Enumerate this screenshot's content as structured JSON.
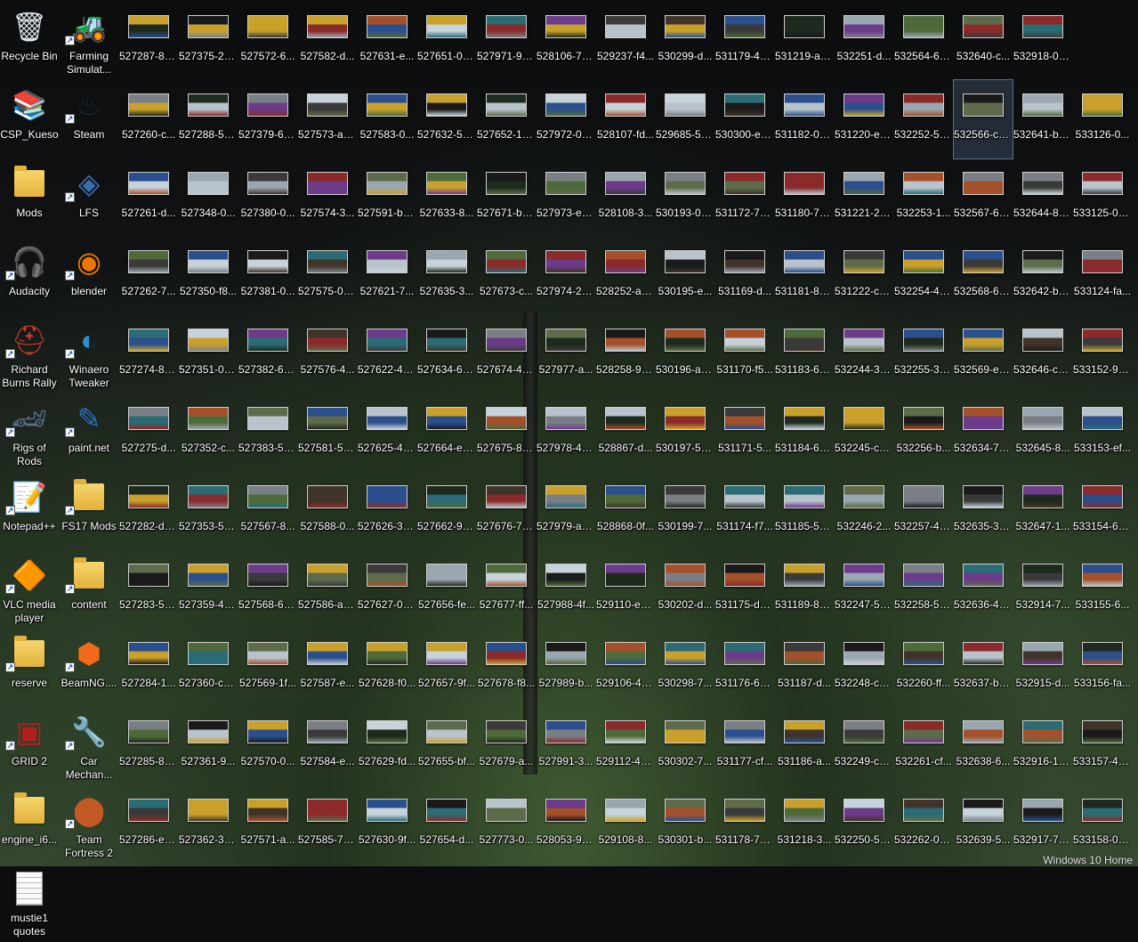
{
  "watermark": "Windows 10 Home",
  "apps": [
    {
      "label": "Recycle Bin",
      "icon": "recycle-bin-icon",
      "glyph": "🗑",
      "color": "#dfe6ee",
      "shortcut": false
    },
    {
      "label": "Farming Simulat...",
      "icon": "farming-simulator-icon",
      "glyph": "🚜",
      "color": "#7fa84a",
      "shortcut": true
    },
    {
      "label": "CSP_Kueso",
      "icon": "winrar-archive-icon",
      "glyph": "📚",
      "color": "#8a3b9e",
      "shortcut": false
    },
    {
      "label": "Steam",
      "icon": "steam-icon",
      "glyph": "♨",
      "color": "#1b2838",
      "shortcut": true
    },
    {
      "label": "Mods",
      "icon": "folder-icon",
      "glyph": "",
      "color": "#e3b23c",
      "shortcut": false,
      "type": "folder"
    },
    {
      "label": "LFS",
      "icon": "lfs-icon",
      "glyph": "◈",
      "color": "#3c6fb0",
      "shortcut": true
    },
    {
      "label": "Audacity",
      "icon": "audacity-icon",
      "glyph": "🎧",
      "color": "#f07a1a",
      "shortcut": true
    },
    {
      "label": "blender",
      "icon": "blender-icon",
      "glyph": "◉",
      "color": "#ea7600",
      "shortcut": true
    },
    {
      "label": "Richard Burns Rally",
      "icon": "helmet-icon",
      "glyph": "⛑",
      "color": "#c0392b",
      "shortcut": true
    },
    {
      "label": "Winaero Tweaker",
      "icon": "winaero-tweaker-icon",
      "glyph": "◐",
      "color": "#2b8fd6",
      "shortcut": true
    },
    {
      "label": "Rigs of Rods",
      "icon": "rigs-of-rods-icon",
      "glyph": "🏎",
      "color": "#5d6f8c",
      "shortcut": true
    },
    {
      "label": "paint.net",
      "icon": "paint-net-icon",
      "glyph": "✎",
      "color": "#2d6fc0",
      "shortcut": true
    },
    {
      "label": "Notepad++",
      "icon": "notepad-plus-plus-icon",
      "glyph": "📝",
      "color": "#8fbf3f",
      "shortcut": true
    },
    {
      "label": "FS17 Mods",
      "icon": "folder-icon",
      "glyph": "",
      "color": "#e3b23c",
      "shortcut": true,
      "type": "folder"
    },
    {
      "label": "VLC media player",
      "icon": "vlc-icon",
      "glyph": "🔶",
      "color": "#f48b00",
      "shortcut": true
    },
    {
      "label": "content",
      "icon": "folder-icon",
      "glyph": "",
      "color": "#e3b23c",
      "shortcut": true,
      "type": "folder"
    },
    {
      "label": "reserve",
      "icon": "folder-icon",
      "glyph": "",
      "color": "#e3b23c",
      "shortcut": true,
      "type": "folder"
    },
    {
      "label": "BeamNG....",
      "icon": "beamng-icon",
      "glyph": "⬢",
      "color": "#f26a1b",
      "shortcut": true
    },
    {
      "label": "GRID 2",
      "icon": "grid2-icon",
      "glyph": "▣",
      "color": "#b21f1f",
      "shortcut": true
    },
    {
      "label": "Car Mechan...",
      "icon": "car-mechanic-icon",
      "glyph": "🔧",
      "color": "#e05a1a",
      "shortcut": true
    },
    {
      "label": "engine_i6...",
      "icon": "folder-icon",
      "glyph": "",
      "color": "#e3b23c",
      "shortcut": false,
      "type": "folder"
    },
    {
      "label": "Team Fortress 2",
      "icon": "team-fortress-icon",
      "glyph": "⬤",
      "color": "#c35a25",
      "shortcut": true
    },
    {
      "label": "mustie1 quotes",
      "icon": "text-document-icon",
      "glyph": "",
      "color": "#ffffff",
      "shortcut": false,
      "type": "doc"
    }
  ],
  "thumb_columns": [
    [
      "527287-81...",
      "527260-c...",
      "527261-d...",
      "527262-7...",
      "527274-81...",
      "527275-d...",
      "527282-d0...",
      "527283-5c...",
      "527284-1...",
      "527285-83...",
      "527286-e7..."
    ],
    [
      "527375-25...",
      "527288-57...",
      "527348-0...",
      "527350-f8...",
      "527351-03...",
      "527352-c...",
      "527353-55...",
      "527359-4a...",
      "527360-c4...",
      "527361-9...",
      "527362-30..."
    ],
    [
      "527572-6...",
      "527379-6a...",
      "527380-0...",
      "527381-0...",
      "527382-67...",
      "527383-58...",
      "527567-8...",
      "527568-6e...",
      "527569-1f...",
      "527570-0...",
      "527571-a..."
    ],
    [
      "527582-d...",
      "527573-a3...",
      "527574-3...",
      "527575-0a...",
      "527576-4...",
      "527581-53...",
      "527588-0...",
      "527586-a6...",
      "527587-e...",
      "527584-e...",
      "527585-73..."
    ],
    [
      "527631-e...",
      "527583-0...",
      "527591-b0...",
      "527621-7...",
      "527622-40...",
      "527625-40...",
      "527626-36...",
      "527627-09...",
      "527628-f0...",
      "527629-fd...",
      "527630-9f..."
    ],
    [
      "527651-0a...",
      "527632-52...",
      "527633-8...",
      "527635-3...",
      "527634-63...",
      "527664-ec...",
      "527662-92...",
      "527656-fe...",
      "527657-9f...",
      "527655-bf...",
      "527654-d..."
    ],
    [
      "527971-92...",
      "527652-1e...",
      "527671-ba...",
      "527673-c...",
      "527674-43...",
      "527675-80...",
      "527676-7e...",
      "527677-ff...",
      "527678-f8...",
      "527679-a...",
      "527773-0..."
    ],
    [
      "528106-77...",
      "527972-04...",
      "527973-ec...",
      "527974-29...",
      "527977-a...",
      "527978-44...",
      "527979-a3...",
      "527988-4f...",
      "527989-b...",
      "527991-3...",
      "528053-98..."
    ],
    [
      "529237-f4...",
      "528107-fd...",
      "528108-3...",
      "528252-a3...",
      "528258-98...",
      "528867-d...",
      "528868-0f...",
      "529110-e1...",
      "529106-47...",
      "529112-44...",
      "529108-8..."
    ],
    [
      "530299-d...",
      "529685-59...",
      "530193-02...",
      "530195-e...",
      "530196-a2...",
      "530197-51...",
      "530199-7...",
      "530202-d...",
      "530298-7...",
      "530302-7...",
      "530301-b..."
    ],
    [
      "531179-40...",
      "530300-e3...",
      "531172-73...",
      "531169-d...",
      "531170-f5...",
      "531171-5...",
      "531174-f7...",
      "531175-d8...",
      "531176-6e...",
      "531177-cf...",
      "531178-73..."
    ],
    [
      "531219-ad...",
      "531182-08...",
      "531180-77...",
      "531181-83...",
      "531183-67...",
      "531184-65...",
      "531185-57...",
      "531189-89...",
      "531187-d...",
      "531186-a...",
      "531218-3..."
    ],
    [
      "532251-d...",
      "531220-e0...",
      "531221-27...",
      "531222-c2...",
      "532244-36...",
      "532245-c2...",
      "532246-2...",
      "532247-57...",
      "532248-c4...",
      "532249-c8...",
      "532250-5d..."
    ],
    [
      "532564-62...",
      "532252-56...",
      "532253-1...",
      "532254-40...",
      "532255-35...",
      "532256-b...",
      "532257-4e...",
      "532258-5a...",
      "532260-ff...",
      "532261-cf...",
      "532262-08..."
    ],
    [
      "532640-c...",
      "532566-ce...",
      "532567-6c...",
      "532568-66...",
      "532569-e0...",
      "532634-74...",
      "532635-35...",
      "532636-46...",
      "532637-b7...",
      "532638-6...",
      "532639-5..."
    ],
    [
      "532918-0d...",
      "532641-b9...",
      "532644-8d...",
      "532642-b6...",
      "532646-c3...",
      "532645-8...",
      "532647-1...",
      "532914-7...",
      "532915-d...",
      "532916-17...",
      "532917-7a..."
    ],
    [
      "",
      "533126-0...",
      "533125-09...",
      "533124-fa...",
      "533152-9a...",
      "533153-ef...",
      "533154-60...",
      "533155-6...",
      "533156-fa...",
      "533157-4e...",
      "533158-00..."
    ]
  ],
  "selected": {
    "col": 14,
    "row": 1
  },
  "thumb_palette": [
    "#5e6b4a",
    "#2a4f8c",
    "#8a2a2a",
    "#7a7f86",
    "#3a3a3a",
    "#b9c3cc",
    "#4f6a3a",
    "#c9a12a",
    "#1e2a1e",
    "#a4502a",
    "#2b6b74",
    "#6c3b8a",
    "#9aa6b0",
    "#40342a",
    "#c7d3da",
    "#1a1a1a"
  ]
}
